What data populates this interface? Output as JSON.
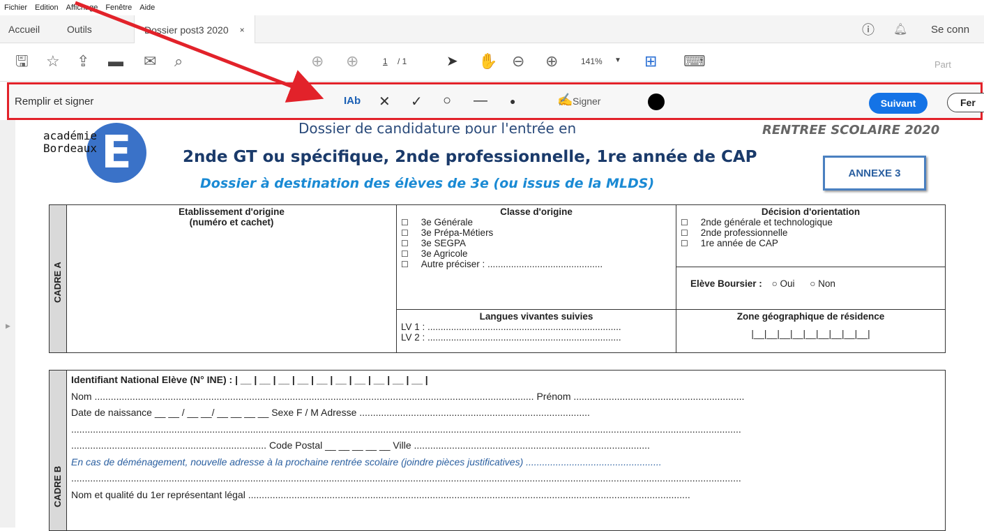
{
  "menu": [
    "Fichier",
    "Edition",
    "Affichage",
    "Fenêtre",
    "Aide"
  ],
  "tabs": {
    "home": "Accueil",
    "tools": "Outils",
    "doc": "Dossier post3 2020",
    "close": "×"
  },
  "tabbar_right": {
    "signin": "Se conn"
  },
  "toolbar": {
    "page_current": "1",
    "page_total": "/ 1",
    "zoom": "141%",
    "share": "Part"
  },
  "fillsign": {
    "title": "Remplir et signer",
    "text_tool": "IAb",
    "sign": "Signer",
    "next": "Suivant",
    "close": "Fer"
  },
  "doc": {
    "header_line1": "Dossier de candidature pour l'entrée en",
    "rentree": "RENTREE SCOLAIRE 2020",
    "logo_line1": "académie",
    "logo_line2": "Bordeaux",
    "logo_letter": "E",
    "title": "2nde GT ou spécifique, 2nde professionnelle, 1re année de CAP",
    "subtitle": "Dossier à destination des élèves de 3e (ou issus de la MLDS)",
    "annexe": "ANNEXE 3",
    "cadre_a": {
      "label": "CADRE A",
      "etab_title": "Etablissement d'origine",
      "etab_sub": "(numéro et cachet)",
      "classe_title": "Classe d'origine",
      "classes": [
        "3e Générale",
        "3e Prépa-Métiers",
        "3e SEGPA",
        "3e Agricole",
        "Autre  préciser : ............................................"
      ],
      "decision_title": "Décision d'orientation",
      "decisions": [
        "2nde générale et technologique",
        "2nde professionnelle",
        "1re année de CAP"
      ],
      "boursier": "Elève Boursier :",
      "oui": "○ Oui",
      "non": "○ Non",
      "langues_title": "Langues vivantes suivies",
      "lv1": "LV 1 : ..........................................................................",
      "lv2": "LV 2 : ..........................................................................",
      "zone_title": "Zone géographique de résidence",
      "zone_boxes": "|__|__|__|__|__|__|__|__|__|"
    },
    "cadre_b": {
      "label": "CADRE B",
      "ine": "Identifiant National Elève (N° INE) : | __ | __ | __ | __ | __ | __ | __ | __ | __ | __ |",
      "nom": "Nom .................................................................................................................................................................. Prénom ...............................................................",
      "naissance": "Date de naissance  __ __ / __ __/ __ __ __ __    Sexe  F / M          Adresse .....................................................................................",
      "line_blank1": ".......................................................................................................................................................................................................................................................",
      "cp": "........................................................................ Code Postal  __ __ __ __ __    Ville .......................................................................................",
      "demenagement": "En cas de déménagement, nouvelle adresse à la prochaine rentrée scolaire (joindre pièces justificatives) ..................................................",
      "line_blank2": ".......................................................................................................................................................................................................................................................",
      "representant": "Nom et qualité du 1er représentant légal ..................................................................................................................................................................."
    }
  }
}
